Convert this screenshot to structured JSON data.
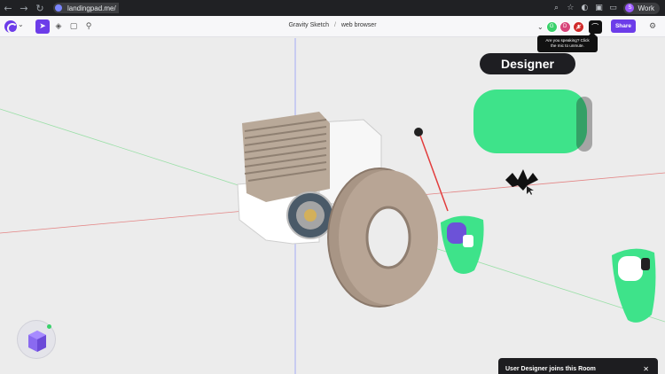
{
  "browser": {
    "url": "landingpad.me/",
    "profile_label": "Work",
    "profile_initial": "S",
    "icons": [
      "back-icon",
      "forward-icon",
      "reload-icon",
      "site-info-icon",
      "zoom-icon",
      "star-icon",
      "extension-icon",
      "extensions-puzzle-icon",
      "separator"
    ]
  },
  "toolbar": {
    "breadcrumb": {
      "app": "Gravity Sketch",
      "separator": "/",
      "page": "web browser"
    },
    "share_label": "Share",
    "tools": [
      "select-tool-icon",
      "layers-icon",
      "comments-icon",
      "search-icon"
    ],
    "avatars": [
      {
        "initial": "G",
        "color": "#3ad16b"
      },
      {
        "initial": "D",
        "color": "#d7457a"
      },
      {
        "initial": "",
        "color": "#d02a2a"
      }
    ]
  },
  "tooltip": {
    "line1": "Are you speaking? Click",
    "line2": "the mic to unmute."
  },
  "scene": {
    "designer_label": "Designer",
    "accent": "#6c3ce9",
    "controller_color": "#3ee38a"
  },
  "toast": {
    "message": "User Designer joins this Room",
    "close": "✕"
  }
}
